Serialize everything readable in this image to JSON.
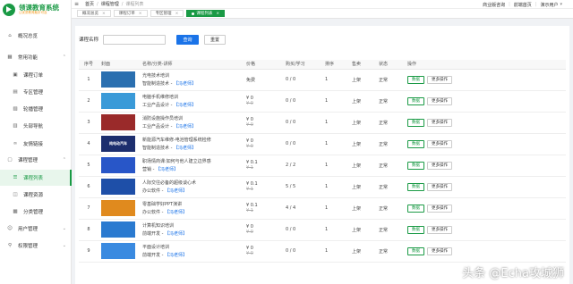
{
  "app": {
    "title": "领课教育系统",
    "slogan": "让优质教育触手可及"
  },
  "header": {
    "breadcrumbs": [
      "首页",
      "课程管理",
      "课程列表"
    ],
    "right_links": [
      "商业版咨询",
      "前端首页",
      "演示用户"
    ]
  },
  "tabs": [
    {
      "label": "概况总览",
      "active": false
    },
    {
      "label": "课程订单",
      "active": false
    },
    {
      "label": "专区管理",
      "active": false
    },
    {
      "label": "课程列表",
      "active": true
    }
  ],
  "sidebar": {
    "items": [
      {
        "label": "概况总览",
        "icon": "home-icon",
        "level": 0,
        "arrow": ""
      },
      {
        "label": "常用功能",
        "icon": "grid-icon",
        "level": 0,
        "arrow": "up"
      },
      {
        "label": "课程订单",
        "icon": "cart-icon",
        "level": 1,
        "arrow": ""
      },
      {
        "label": "专区管理",
        "icon": "folder-icon",
        "level": 1,
        "arrow": ""
      },
      {
        "label": "轮播管理",
        "icon": "image-icon",
        "level": 1,
        "arrow": ""
      },
      {
        "label": "头部导航",
        "icon": "calendar-icon",
        "level": 1,
        "arrow": ""
      },
      {
        "label": "友情链接",
        "icon": "link-icon",
        "level": 1,
        "arrow": ""
      },
      {
        "label": "课程管理",
        "icon": "book-icon",
        "level": 0,
        "arrow": "up"
      },
      {
        "label": "课程列表",
        "icon": "course-list-icon",
        "level": 1,
        "arrow": "",
        "active": true
      },
      {
        "label": "课程资源",
        "icon": "resource-icon",
        "level": 1,
        "arrow": ""
      },
      {
        "label": "分类管理",
        "icon": "category-icon",
        "level": 1,
        "arrow": ""
      },
      {
        "label": "用户管理",
        "icon": "users-icon",
        "level": 0,
        "arrow": "down"
      },
      {
        "label": "权限管理",
        "icon": "user-lock-icon",
        "level": 0,
        "arrow": "down"
      }
    ]
  },
  "filter": {
    "label": "课程名称",
    "placeholder": "",
    "query_label": "查询",
    "reset_label": "重置"
  },
  "table": {
    "headers": [
      "序号",
      "封面",
      "名称/分类-讲师",
      "价格",
      "购买/学习",
      "排序",
      "售卖",
      "状态",
      "操作"
    ],
    "rows": [
      {
        "no": "1",
        "cover_text": "",
        "cover_color": "#2a6fb0",
        "name": "光电技术培训",
        "category": "智能制造技术",
        "teacher": "【冯老师】",
        "price": "免费",
        "old_price": "",
        "buy": "0 / 0",
        "sort": "1",
        "sale": "上架",
        "status": "正常",
        "op_data": "数据",
        "op_more": "更多操作"
      },
      {
        "no": "2",
        "cover_text": "",
        "cover_color": "#3a9ad8",
        "name": "电脑手机维修培训",
        "category": "工业产品设计",
        "teacher": "【冯老师】",
        "price": "¥ 0",
        "old_price": "¥ 0",
        "buy": "0 / 0",
        "sort": "1",
        "sale": "上架",
        "status": "正常",
        "op_data": "数据",
        "op_more": "更多操作"
      },
      {
        "no": "3",
        "cover_text": "",
        "cover_color": "#9a2a2a",
        "name": "消防设施操作员培训",
        "category": "工业产品设计",
        "teacher": "【冯老师】",
        "price": "¥ 0",
        "old_price": "¥ 0",
        "buy": "0 / 0",
        "sort": "1",
        "sale": "上架",
        "status": "正常",
        "op_data": "数据",
        "op_more": "更多操作"
      },
      {
        "no": "4",
        "cover_text": "纯电动汽车",
        "cover_color": "#1c2e6e",
        "name": "新能源汽车维修-电池管理系统检修",
        "category": "智能制造技术",
        "teacher": "【冯老师】",
        "price": "¥ 0",
        "old_price": "¥ 0",
        "buy": "0 / 0",
        "sort": "1",
        "sale": "上架",
        "status": "正常",
        "op_data": "数据",
        "op_more": "更多操作"
      },
      {
        "no": "5",
        "cover_text": "",
        "cover_color": "#2856c8",
        "name": "职场情商课:如何与他人建立边界感",
        "category": "营销",
        "teacher": "【冯老师】",
        "price": "¥ 0.1",
        "old_price": "¥ 1",
        "buy": "2 / 2",
        "sort": "1",
        "sale": "上架",
        "status": "正常",
        "op_data": "数据",
        "op_more": "更多操作"
      },
      {
        "no": "6",
        "cover_text": "",
        "cover_color": "#1e4fa8",
        "name": "人际交往必备的超级谈心术",
        "category": "办公软件",
        "teacher": "【冯老师】",
        "price": "¥ 0.1",
        "old_price": "¥ 1",
        "buy": "5 / 5",
        "sort": "1",
        "sale": "上架",
        "status": "正常",
        "op_data": "数据",
        "op_more": "更多操作"
      },
      {
        "no": "7",
        "cover_text": "",
        "cover_color": "#e08a1e",
        "name": "零基础学好PPT演讲",
        "category": "办公软件",
        "teacher": "【冯老师】",
        "price": "¥ 0.1",
        "old_price": "¥ 1",
        "buy": "4 / 4",
        "sort": "1",
        "sale": "上架",
        "status": "正常",
        "op_data": "数据",
        "op_more": "更多操作"
      },
      {
        "no": "8",
        "cover_text": "",
        "cover_color": "#2a7ad0",
        "name": "计算机知识培训",
        "category": "前端开发",
        "teacher": "【冯老师】",
        "price": "¥ 0",
        "old_price": "¥ 0",
        "buy": "0 / 0",
        "sort": "1",
        "sale": "上架",
        "status": "正常",
        "op_data": "数据",
        "op_more": "更多操作"
      },
      {
        "no": "9",
        "cover_text": "",
        "cover_color": "#3a8ae0",
        "name": "平面设计培训",
        "category": "前端开发",
        "teacher": "【冯老师】",
        "price": "¥ 0",
        "old_price": "¥ 0",
        "buy": "0 / 0",
        "sort": "1",
        "sale": "上架",
        "status": "正常",
        "op_data": "数据",
        "op_more": "更多操作"
      }
    ]
  },
  "watermark": "头条 @Echa攻城狮",
  "colors": {
    "brand": "#1a9a45",
    "primary": "#1a73e8"
  }
}
